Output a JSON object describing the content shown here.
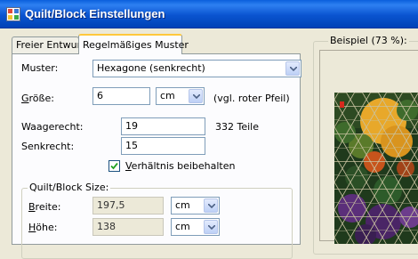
{
  "window": {
    "title": "Quilt/Block Einstellungen",
    "icon": "quilt-app-icon"
  },
  "tabs": [
    {
      "label": "Freier Entwurf",
      "active": false
    },
    {
      "label": "Regelmäßiges Muster",
      "active": true
    }
  ],
  "form": {
    "muster_label": "Muster:",
    "muster_value": "Hexagone (senkrecht)",
    "groesse_label_u": "G",
    "groesse_label_rest": "röße:",
    "groesse_value": "6",
    "groesse_unit": "cm",
    "groesse_hint": "(vgl. roter Pfeil)",
    "waagerecht_label": "Waagerecht:",
    "waagerecht_value": "19",
    "teile_count": "332 Teile",
    "senkrecht_label": "Senkrecht:",
    "senkrecht_value": "15",
    "verhaeltnis_label_u": "V",
    "verhaeltnis_label_rest": "erhältnis beibehalten",
    "verhaeltnis_checked": true
  },
  "size_group": {
    "title": "Quilt/Block Size:",
    "breite_label_u": "B",
    "breite_label_rest": "reite:",
    "breite_value": "197,5",
    "breite_unit": "cm",
    "hoehe_label_u": "H",
    "hoehe_label_rest": "öhe:",
    "hoehe_value": "138",
    "hoehe_unit": "cm"
  },
  "preview": {
    "title": "Beispiel (73 %):"
  },
  "colors": {
    "accent_tab": "#ffc83c",
    "titlebar": "#0a54d0",
    "input_border": "#7f9db9"
  }
}
